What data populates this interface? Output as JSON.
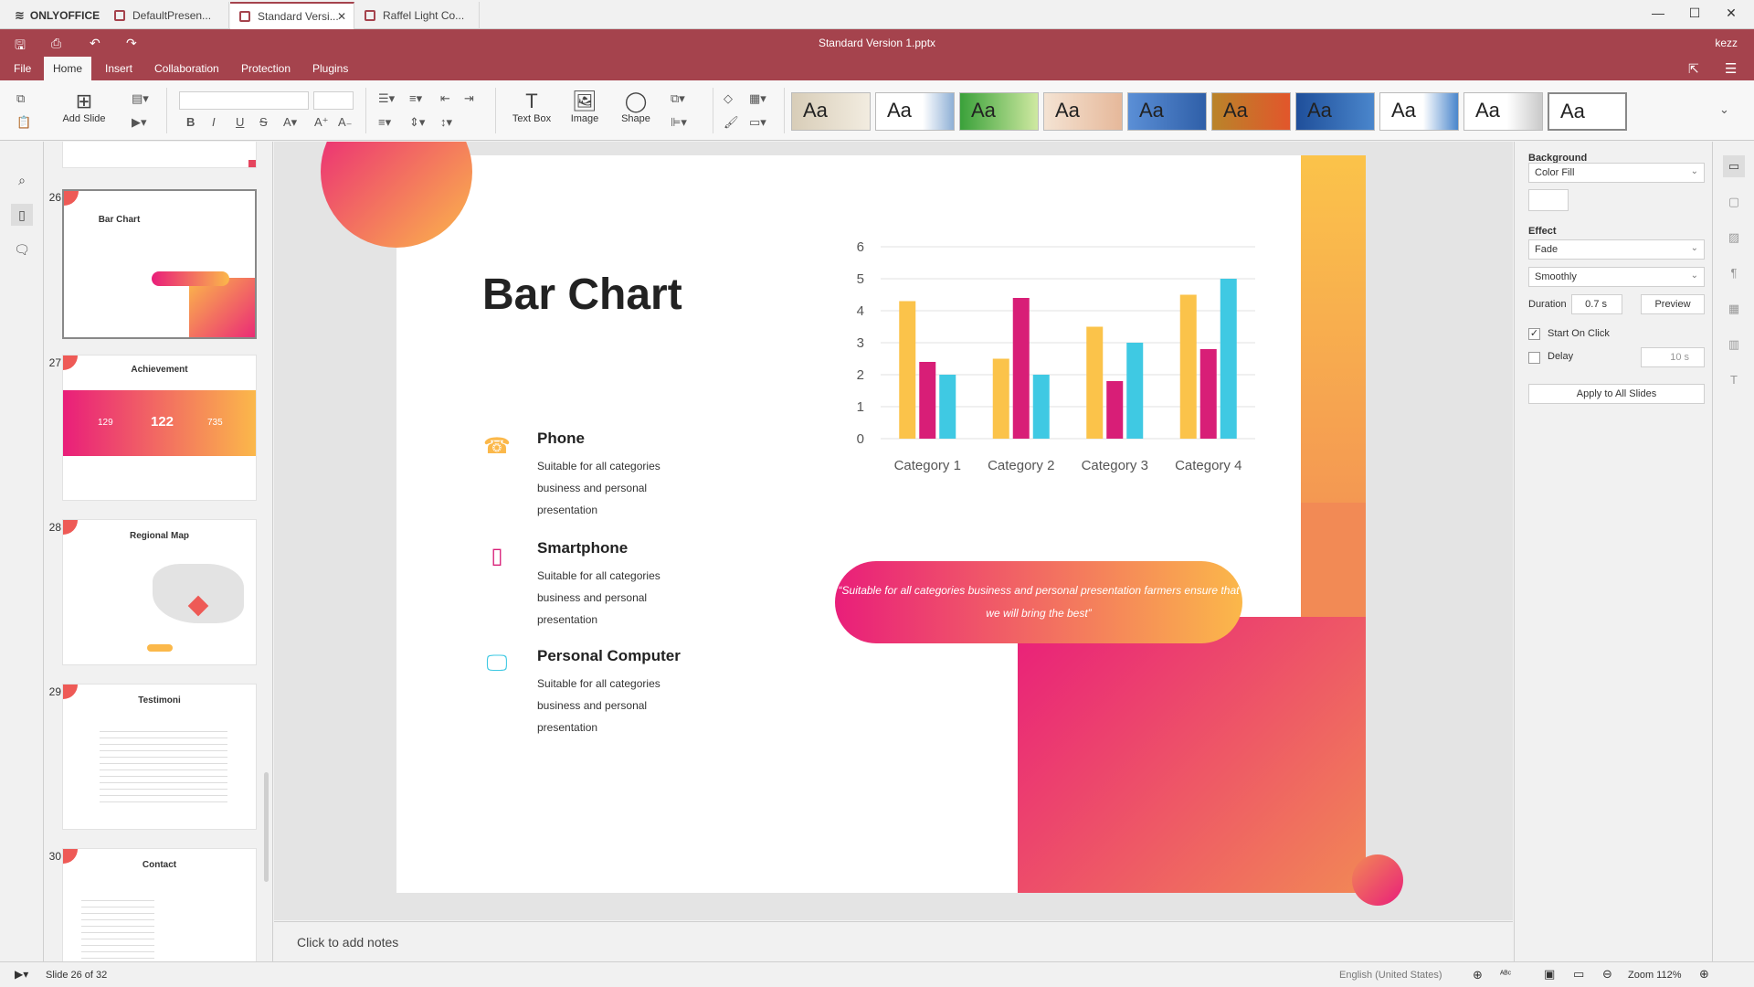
{
  "app": {
    "logo": "ONLYOFFICE",
    "user": "kezz"
  },
  "tabs": [
    {
      "label": "DefaultPresen..."
    },
    {
      "label": "Standard Versi..."
    },
    {
      "label": "Raffel Light Co..."
    }
  ],
  "window": {
    "title": "Standard Version 1.pptx",
    "minimize": "—",
    "maximize": "☐",
    "close": "✕"
  },
  "menu": [
    "File",
    "Home",
    "Insert",
    "Collaboration",
    "Protection",
    "Plugins"
  ],
  "toolbar": {
    "add_slide": "Add Slide",
    "text_box": "Text Box",
    "image": "Image",
    "shape": "Shape",
    "theme_sample": "Aa"
  },
  "thumbnails": [
    {
      "num": "26",
      "title": "Bar Chart"
    },
    {
      "num": "27",
      "title": "Achievement",
      "stats": [
        "129",
        "122",
        "735"
      ]
    },
    {
      "num": "28",
      "title": "Regional Map"
    },
    {
      "num": "29",
      "title": "Testimoni"
    },
    {
      "num": "30",
      "title": "Contact"
    }
  ],
  "slide": {
    "title": "Bar Chart",
    "features": [
      {
        "heading": "Phone",
        "desc": "Suitable for all categories business and personal presentation"
      },
      {
        "heading": "Smartphone",
        "desc": "Suitable for all categories business and personal presentation"
      },
      {
        "heading": "Personal Computer",
        "desc": "Suitable for all categories business and personal presentation"
      }
    ],
    "quote": "“Suitable for all categories business and personal presentation farmers ensure that we will bring the best”"
  },
  "chart_data": {
    "type": "bar",
    "categories": [
      "Category 1",
      "Category 2",
      "Category 3",
      "Category 4"
    ],
    "series": [
      {
        "values": [
          4.3,
          2.5,
          3.5,
          4.5
        ],
        "color": "#fbc34a"
      },
      {
        "values": [
          2.4,
          4.4,
          1.8,
          2.8
        ],
        "color": "#d81e77"
      },
      {
        "values": [
          2.0,
          2.0,
          3.0,
          5.0
        ],
        "color": "#3fc9e3"
      }
    ],
    "yticks": [
      "0",
      "1",
      "2",
      "3",
      "4",
      "5",
      "6"
    ],
    "ylim": [
      0,
      6
    ],
    "grid": true
  },
  "notes": {
    "placeholder": "Click to add notes"
  },
  "panel": {
    "background_label": "Background",
    "background_value": "Color Fill",
    "effect_label": "Effect",
    "effect_value": "Fade",
    "effect_type": "Smoothly",
    "duration_label": "Duration",
    "duration_value": "0.7 s",
    "preview": "Preview",
    "start_on_click": "Start On Click",
    "delay_label": "Delay",
    "delay_value": "10 s",
    "apply_all": "Apply to All Slides"
  },
  "status": {
    "slide_info": "Slide 26 of 32",
    "language": "English (United States)",
    "zoom": "Zoom 112%"
  },
  "colors": {
    "brand": "#a5434d",
    "accent_pink": "#e91e7a",
    "accent_orange": "#fbb84a",
    "accent_cyan": "#3fc9e3"
  }
}
